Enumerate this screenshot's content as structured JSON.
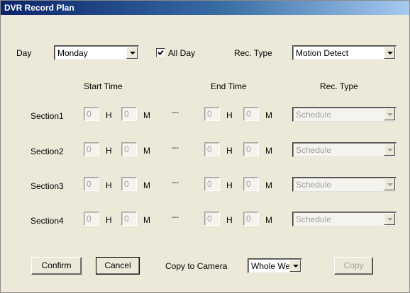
{
  "window": {
    "title": "DVR Record Plan"
  },
  "top": {
    "day_label": "Day",
    "day_value": "Monday",
    "all_day_label": "All Day",
    "all_day_checked": true,
    "rec_type_label": "Rec. Type",
    "rec_type_value": "Motion Detect"
  },
  "headers": {
    "start": "Start Time",
    "end": "End Time",
    "rec_type": "Rec. Type"
  },
  "units": {
    "hour": "H",
    "minute": "M",
    "separator": "---"
  },
  "sections": [
    {
      "label": "Section1",
      "start_h": "0",
      "start_m": "0",
      "end_h": "0",
      "end_m": "0",
      "type": "Schedule"
    },
    {
      "label": "Section2",
      "start_h": "0",
      "start_m": "0",
      "end_h": "0",
      "end_m": "0",
      "type": "Schedule"
    },
    {
      "label": "Section3",
      "start_h": "0",
      "start_m": "0",
      "end_h": "0",
      "end_m": "0",
      "type": "Schedule"
    },
    {
      "label": "Section4",
      "start_h": "0",
      "start_m": "0",
      "end_h": "0",
      "end_m": "0",
      "type": "Schedule"
    }
  ],
  "footer": {
    "confirm": "Confirm",
    "cancel": "Cancel",
    "copy_to_camera_label": "Copy to Camera",
    "copy_target": "Whole Wee",
    "copy": "Copy"
  }
}
